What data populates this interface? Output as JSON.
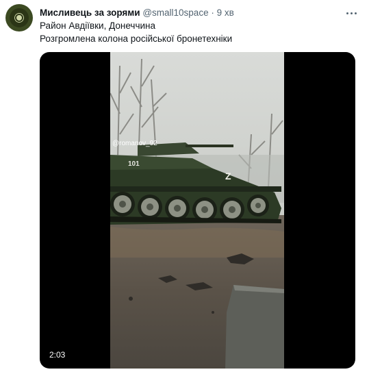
{
  "tweet": {
    "author_name": "Мисливець за зорями",
    "handle": "@small10space",
    "separator": "·",
    "time": "9 хв",
    "lines": [
      "Район Авдіївки, Донеччина",
      "Розгромлена колона російської бронетехніки"
    ]
  },
  "video": {
    "watermark": "@romanov_92",
    "tank_number": "101",
    "tank_marking": "Z",
    "duration": "2:03"
  },
  "icons": {
    "avatar": "profile-avatar",
    "more": "more-horizontal-icon"
  }
}
